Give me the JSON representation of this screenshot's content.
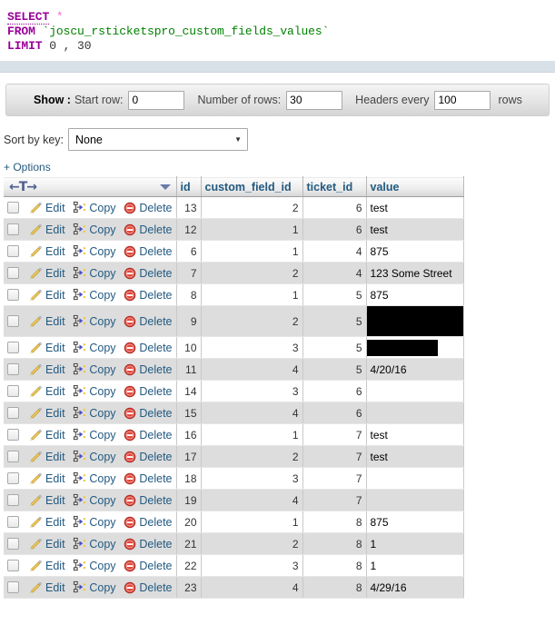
{
  "sql": {
    "line1_kw": "SELECT",
    "line1_star": "*",
    "line2_kw": "FROM",
    "line2_table": "`joscu_rsticketspro_custom_fields_values`",
    "line3_kw": "LIMIT",
    "line3_args": "0 , 30"
  },
  "show_bar": {
    "title": "Show :",
    "start_row_label": "Start row:",
    "start_row_value": "0",
    "num_rows_label": "Number of rows:",
    "num_rows_value": "30",
    "headers_every_label": "Headers every",
    "headers_every_value": "100",
    "rows_suffix": "rows"
  },
  "sort": {
    "label": "Sort by key:",
    "selected": "None",
    "options": [
      "None"
    ]
  },
  "options_link": "+ Options",
  "table": {
    "nav_icon": "←T→",
    "columns": [
      "id",
      "custom_field_id",
      "ticket_id",
      "value"
    ],
    "row_actions": {
      "edit": "Edit",
      "copy": "Copy",
      "delete": "Delete"
    },
    "rows": [
      {
        "id": "13",
        "custom_field_id": "2",
        "ticket_id": "6",
        "value": "test",
        "redacted": false
      },
      {
        "id": "12",
        "custom_field_id": "1",
        "ticket_id": "6",
        "value": "test",
        "redacted": false
      },
      {
        "id": "6",
        "custom_field_id": "1",
        "ticket_id": "4",
        "value": "875",
        "redacted": false
      },
      {
        "id": "7",
        "custom_field_id": "2",
        "ticket_id": "4",
        "value": "123 Some Street",
        "redacted": false
      },
      {
        "id": "8",
        "custom_field_id": "1",
        "ticket_id": "5",
        "value": "875",
        "redacted": false
      },
      {
        "id": "9",
        "custom_field_id": "2",
        "ticket_id": "5",
        "value": "",
        "redacted": true,
        "redact_width": 122,
        "redact_height": 33
      },
      {
        "id": "10",
        "custom_field_id": "3",
        "ticket_id": "5",
        "value": "",
        "redacted": true,
        "redact_width": 78,
        "redact_height": 18
      },
      {
        "id": "11",
        "custom_field_id": "4",
        "ticket_id": "5",
        "value": "4/20/16",
        "redacted": false
      },
      {
        "id": "14",
        "custom_field_id": "3",
        "ticket_id": "6",
        "value": "",
        "redacted": false
      },
      {
        "id": "15",
        "custom_field_id": "4",
        "ticket_id": "6",
        "value": "",
        "redacted": false
      },
      {
        "id": "16",
        "custom_field_id": "1",
        "ticket_id": "7",
        "value": "test",
        "redacted": false
      },
      {
        "id": "17",
        "custom_field_id": "2",
        "ticket_id": "7",
        "value": "test",
        "redacted": false
      },
      {
        "id": "18",
        "custom_field_id": "3",
        "ticket_id": "7",
        "value": "",
        "redacted": false
      },
      {
        "id": "19",
        "custom_field_id": "4",
        "ticket_id": "7",
        "value": "",
        "redacted": false
      },
      {
        "id": "20",
        "custom_field_id": "1",
        "ticket_id": "8",
        "value": "875",
        "redacted": false
      },
      {
        "id": "21",
        "custom_field_id": "2",
        "ticket_id": "8",
        "value": "1",
        "redacted": false
      },
      {
        "id": "22",
        "custom_field_id": "3",
        "ticket_id": "8",
        "value": "1",
        "redacted": false
      },
      {
        "id": "23",
        "custom_field_id": "4",
        "ticket_id": "8",
        "value": "4/29/16",
        "redacted": false
      }
    ]
  },
  "colors": {
    "link": "#235a81",
    "sql_keyword": "#990099",
    "sql_string": "#008000",
    "row_alt": "#dddddd",
    "redaction": "#000000"
  }
}
